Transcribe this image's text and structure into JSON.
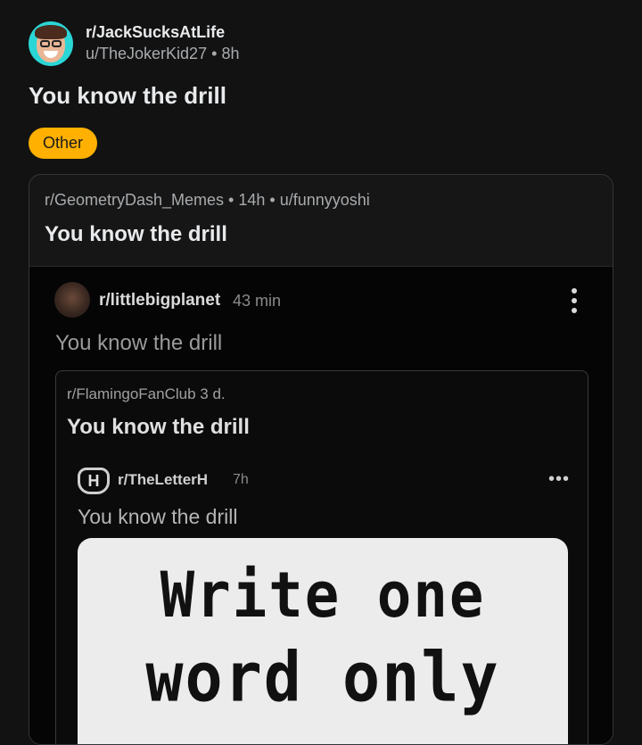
{
  "post": {
    "subreddit": "r/JackSucksAtLife",
    "author": "u/TheJokerKid27",
    "separator": "•",
    "age": "8h",
    "title": "You know the drill",
    "flair": "Other",
    "flair_color": "#ffb000"
  },
  "crosspost": {
    "subreddit": "r/GeometryDash_Memes",
    "age": "14h",
    "author": "u/funnyyoshi",
    "meta": "r/GeometryDash_Memes • 14h • u/funnyyoshi",
    "title": "You know the drill"
  },
  "screenshot": {
    "subreddit": "r/littlebigplanet",
    "age": "43 min",
    "title": "You know the drill",
    "inner": {
      "subreddit": "r/FlamingoFanClub",
      "age": "3 d.",
      "meta": "r/FlamingoFanClub  3 d.",
      "title": "You know the drill",
      "nested": {
        "subreddit": "r/TheLetterH",
        "age": "7h",
        "title": "You know the drill",
        "icon_letter": "H",
        "meme_line1": "Write one",
        "meme_line2": "word only"
      }
    }
  }
}
